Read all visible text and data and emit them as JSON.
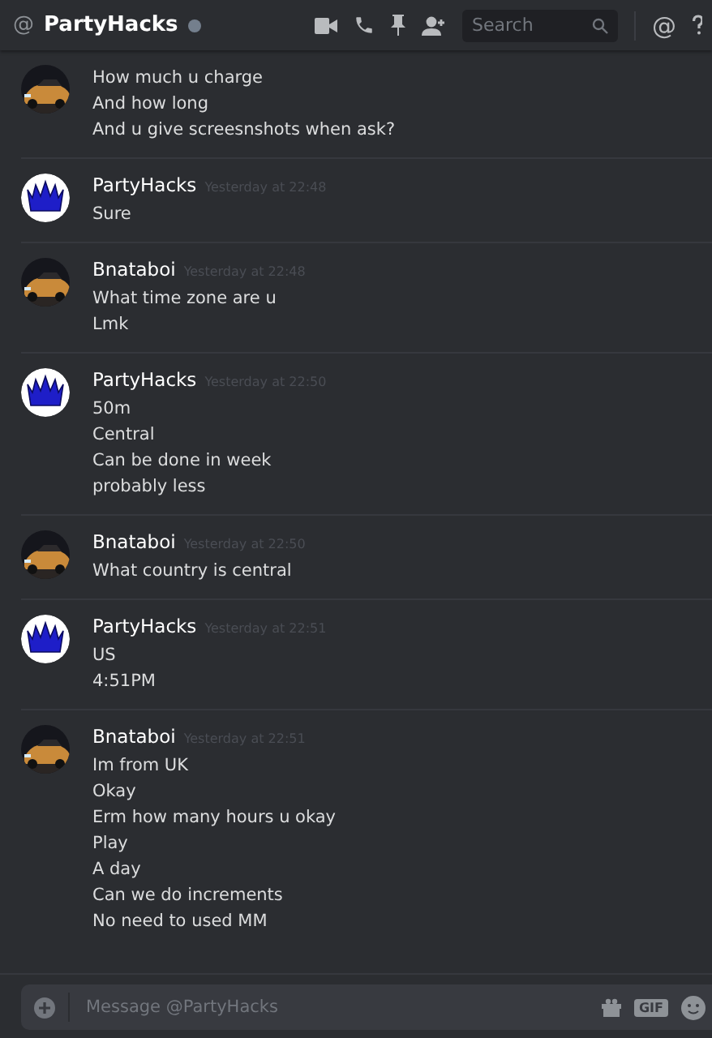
{
  "header": {
    "at_sign": "@",
    "title": "PartyHacks",
    "online": false,
    "search": {
      "placeholder": "Search"
    },
    "mentions": "@"
  },
  "messages": [
    {
      "kind": "car",
      "lines": [
        "How much u charge",
        "And how long",
        "And u give screesnshots when ask?"
      ]
    },
    {
      "kind": "crown",
      "author": "PartyHacks",
      "time": "Yesterday at 22:48",
      "lines": [
        "Sure"
      ]
    },
    {
      "kind": "car",
      "author": "Bnataboi",
      "time": "Yesterday at 22:48",
      "lines": [
        "What time zone are u",
        "Lmk"
      ]
    },
    {
      "kind": "crown",
      "author": "PartyHacks",
      "time": "Yesterday at 22:50",
      "lines": [
        "50m",
        "Central",
        "Can be done in week",
        "probably less"
      ]
    },
    {
      "kind": "car",
      "author": "Bnataboi",
      "time": "Yesterday at 22:50",
      "lines": [
        "What country is central"
      ]
    },
    {
      "kind": "crown",
      "author": "PartyHacks",
      "time": "Yesterday at 22:51",
      "lines": [
        "US",
        "4:51PM"
      ]
    },
    {
      "kind": "car",
      "author": "Bnataboi",
      "time": "Yesterday at 22:51",
      "lines": [
        "Im from UK",
        "Okay",
        "Erm how many hours u okay",
        "Play",
        "A day",
        "Can we do increments",
        "No need to used MM"
      ]
    }
  ],
  "composer": {
    "placeholder": "Message @PartyHacks",
    "gif": "GIF"
  }
}
